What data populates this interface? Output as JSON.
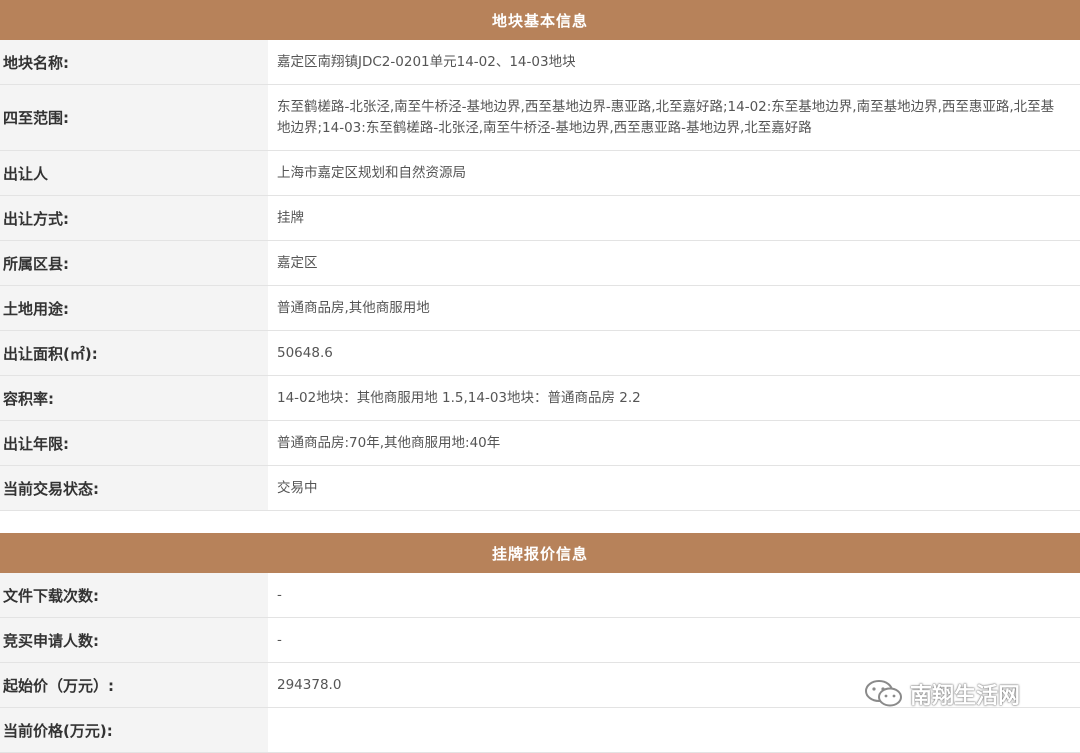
{
  "section1": {
    "title": "地块基本信息",
    "rows": [
      {
        "label": "地块名称:",
        "value": "嘉定区南翔镇JDC2-0201单元14-02、14-03地块"
      },
      {
        "label": "四至范围:",
        "value": "东至鹤槎路-北张泾,南至牛桥泾-基地边界,西至基地边界-惠亚路,北至嘉好路;14-02:东至基地边界,南至基地边界,西至惠亚路,北至基地边界;14-03:东至鹤槎路-北张泾,南至牛桥泾-基地边界,西至惠亚路-基地边界,北至嘉好路"
      },
      {
        "label": "出让人",
        "value": "上海市嘉定区规划和自然资源局"
      },
      {
        "label": "出让方式:",
        "value": "挂牌"
      },
      {
        "label": "所属区县:",
        "value": "嘉定区"
      },
      {
        "label": "土地用途:",
        "value": "普通商品房,其他商服用地"
      },
      {
        "label": "出让面积(㎡):",
        "value": "50648.6"
      },
      {
        "label": "容积率:",
        "value": "14-02地块：其他商服用地 1.5,14-03地块：普通商品房 2.2"
      },
      {
        "label": "出让年限:",
        "value": "普通商品房:70年,其他商服用地:40年"
      },
      {
        "label": "当前交易状态:",
        "value": "交易中"
      }
    ]
  },
  "section2": {
    "title": "挂牌报价信息",
    "rows": [
      {
        "label": "文件下载次数:",
        "value": "-"
      },
      {
        "label": "竞买申请人数:",
        "value": "-"
      },
      {
        "label": "起始价（万元）:",
        "value": "294378.0"
      },
      {
        "label": "当前价格(万元):",
        "value": ""
      }
    ]
  },
  "watermark": {
    "text": "南翔生活网",
    "icon": "wechat-icon"
  },
  "colors": {
    "header_bg": "#b7825a",
    "label_bg": "#f4f4f4",
    "border": "#e3e3e3"
  }
}
